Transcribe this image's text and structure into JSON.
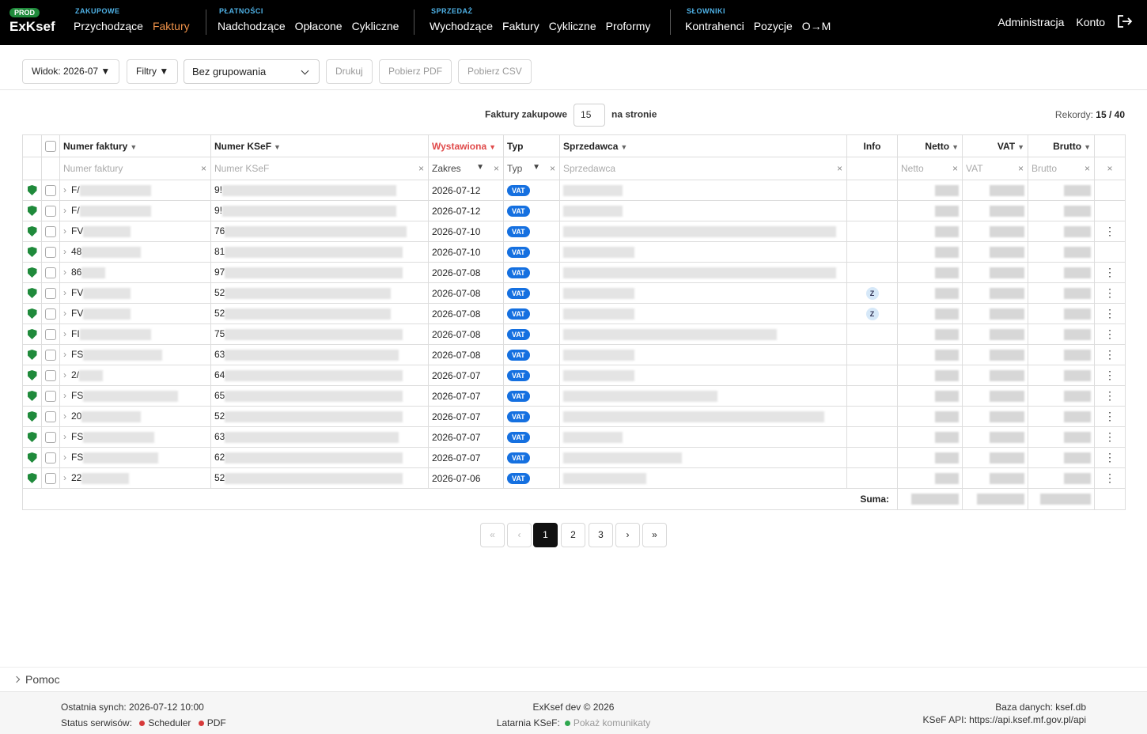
{
  "header": {
    "env_badge": "PROD",
    "logo": "ExKsef",
    "groups": [
      {
        "label": "ZAKUPOWE",
        "items": [
          "Przychodzące",
          "Faktury"
        ],
        "active": 1
      },
      {
        "label": "PŁATNOŚCI",
        "items": [
          "Nadchodzące",
          "Opłacone",
          "Cykliczne"
        ]
      },
      {
        "label": "SPRZEDAŻ",
        "items": [
          "Wychodzące",
          "Faktury",
          "Cykliczne",
          "Proformy"
        ]
      },
      {
        "label": "SŁOWNIKI",
        "items": [
          "Kontrahenci",
          "Pozycje",
          "O→M"
        ]
      }
    ],
    "right": [
      "Administracja",
      "Konto"
    ],
    "logout_icon": "logout-icon"
  },
  "toolbar": {
    "view": "Widok: 2026-07 ▼",
    "filters": "Filtry ▼",
    "grouping": "Bez grupowania",
    "print": "Drukuj",
    "pdf": "Pobierz PDF",
    "csv": "Pobierz CSV"
  },
  "paging_bar": {
    "prefix": "Faktury zakupowe",
    "per_page": "15",
    "suffix": "na stronie",
    "records_label": "Rekordy:",
    "records_value": "15 / 40"
  },
  "table": {
    "columns": {
      "number": "Numer faktury",
      "ksef": "Numer KSeF",
      "issued": "Wystawiona",
      "type": "Typ",
      "seller": "Sprzedawca",
      "info": "Info",
      "net": "Netto",
      "vat": "VAT",
      "gross": "Brutto"
    },
    "filters": {
      "number": "Numer faktury",
      "ksef": "Numer KSeF",
      "issued": "Zakres",
      "type": "Typ",
      "seller": "Sprzedawca",
      "net": "Netto",
      "vat": "VAT",
      "gross": "Brutto"
    },
    "rows": [
      {
        "num": "F/",
        "ksef": "9!",
        "date": "2026-07-12",
        "type": "VAT",
        "info": "",
        "menu": false
      },
      {
        "num": "F/",
        "ksef": "9!",
        "date": "2026-07-12",
        "type": "VAT",
        "info": "",
        "menu": false
      },
      {
        "num": "FV",
        "ksef": "76",
        "date": "2026-07-10",
        "type": "VAT",
        "info": "",
        "menu": true
      },
      {
        "num": "48",
        "ksef": "81",
        "date": "2026-07-10",
        "type": "VAT",
        "info": "",
        "menu": false
      },
      {
        "num": "86",
        "ksef": "97",
        "date": "2026-07-08",
        "type": "VAT",
        "info": "",
        "menu": true
      },
      {
        "num": "FV",
        "ksef": "52",
        "date": "2026-07-08",
        "type": "VAT",
        "info": "Z",
        "menu": true
      },
      {
        "num": "FV",
        "ksef": "52",
        "date": "2026-07-08",
        "type": "VAT",
        "info": "Z",
        "menu": true
      },
      {
        "num": "FI",
        "ksef": "75",
        "date": "2026-07-08",
        "type": "VAT",
        "info": "",
        "menu": true
      },
      {
        "num": "FS",
        "ksef": "63",
        "date": "2026-07-08",
        "type": "VAT",
        "info": "",
        "menu": true
      },
      {
        "num": "2/",
        "ksef": "64",
        "date": "2026-07-07",
        "type": "VAT",
        "info": "",
        "menu": true
      },
      {
        "num": "FS",
        "ksef": "65",
        "date": "2026-07-07",
        "type": "VAT",
        "info": "",
        "menu": true
      },
      {
        "num": "20",
        "ksef": "52",
        "date": "2026-07-07",
        "type": "VAT",
        "info": "",
        "menu": true
      },
      {
        "num": "FS",
        "ksef": "63",
        "date": "2026-07-07",
        "type": "VAT",
        "info": "",
        "menu": true
      },
      {
        "num": "FS",
        "ksef": "62",
        "date": "2026-07-07",
        "type": "VAT",
        "info": "",
        "menu": true
      },
      {
        "num": "22",
        "ksef": "52",
        "date": "2026-07-06",
        "type": "VAT",
        "info": "",
        "menu": true
      }
    ],
    "sum_label": "Suma:"
  },
  "pagination": {
    "first": "«",
    "prev": "‹",
    "pages": [
      "1",
      "2",
      "3"
    ],
    "current": "1",
    "next": "›",
    "last": "»"
  },
  "help": "Pomoc",
  "footer": {
    "sync": "Ostatnia synch: 2026-07-12 10:00",
    "services_label": "Status serwisów:",
    "services": [
      {
        "name": "Scheduler",
        "color": "#d63a3a"
      },
      {
        "name": "PDF",
        "color": "#d63a3a"
      }
    ],
    "copyright": "ExKsef dev © 2026",
    "lighthouse_label": "Latarnia KSeF:",
    "lighthouse_link": "Pokaż komunikaty",
    "lighthouse_color": "#2fa84f",
    "db": "Baza danych: ksef.db",
    "api": "KSeF API: https://api.ksef.mf.gov.pl/api"
  }
}
